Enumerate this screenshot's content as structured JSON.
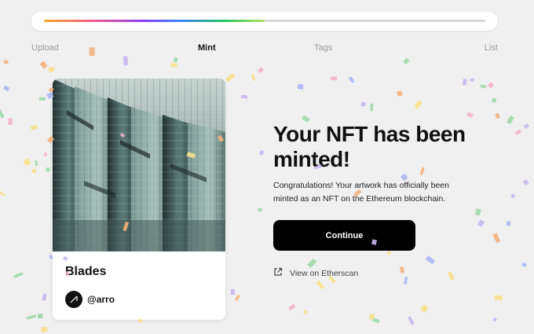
{
  "progress": {
    "fraction": 0.5,
    "steps": [
      {
        "label": "Upload",
        "active": false
      },
      {
        "label": "Mint",
        "active": true
      },
      {
        "label": "Tags",
        "active": false
      },
      {
        "label": "List",
        "active": false
      }
    ]
  },
  "nft_card": {
    "title": "Blades",
    "creator": "@arro",
    "avatar_icon": "arrow-logo-icon"
  },
  "success": {
    "headline": "Your NFT has been minted!",
    "description": "Congratulations! Your artwork has officially been minted as an NFT on the Ethereum blockchain.",
    "continue_label": "Continue",
    "etherscan_label": "View on Etherscan",
    "etherscan_icon": "external-link-icon"
  },
  "colors": {
    "background": "#f0f0f0",
    "button": "#000000",
    "confetti": [
      "#f5b3c8",
      "#c9b6f2",
      "#9fd8a8",
      "#f7e08a",
      "#a9b7f5",
      "#f4b07c"
    ]
  }
}
